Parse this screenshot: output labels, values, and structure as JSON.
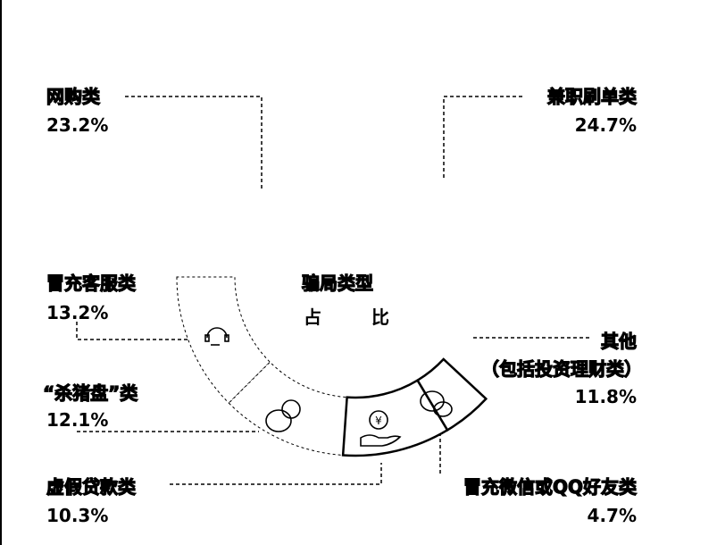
{
  "chart_data": {
    "type": "pie",
    "title": "骗局类型",
    "subtitle_chars": [
      "占",
      "比"
    ],
    "unit": "%",
    "categories": [
      "网购类",
      "兼职刷单类",
      "冒充客服类",
      "“杀猪盘”类",
      "虚假贷款类",
      "冒充微信或QQ好友类",
      "其他",
      "（包括投资理财类）"
    ],
    "slices": [
      {
        "name": "网购类",
        "value": 23.2,
        "label": "23.2%"
      },
      {
        "name": "兼职刷单类",
        "value": 24.7,
        "label": "24.7%"
      },
      {
        "name": "冒充客服类",
        "value": 13.2,
        "label": "13.2%",
        "icon": "headset-icon"
      },
      {
        "name": "“杀猪盘”类",
        "value": 12.1,
        "label": "12.1%",
        "icon": "pig-icon"
      },
      {
        "name": "虚假贷款类",
        "value": 10.3,
        "label": "10.3%",
        "icon": "coin-hand-icon"
      },
      {
        "name": "冒充微信或QQ好友类",
        "value": 4.7,
        "label": "4.7%",
        "icon": "wechat-icon"
      },
      {
        "name": "其他（包括投资理财类）",
        "value": 11.8,
        "label": "11.8%"
      }
    ],
    "colors": {
      "ink": "#000000",
      "background": "#ffffff"
    }
  }
}
